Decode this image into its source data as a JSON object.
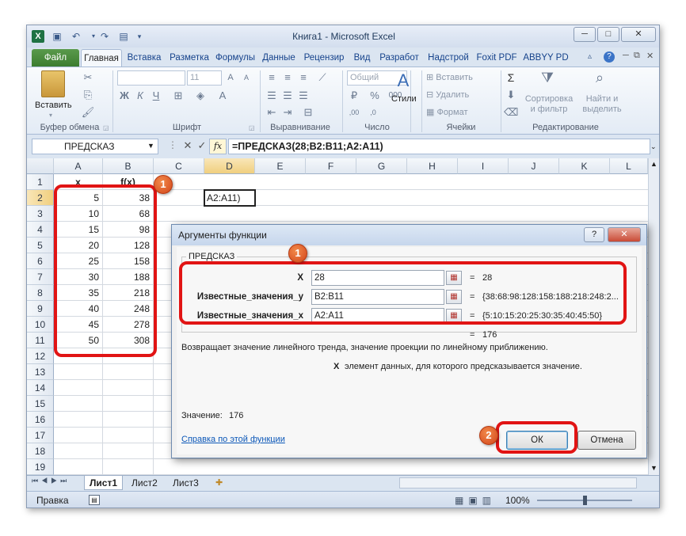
{
  "window": {
    "title": "Книга1 - Microsoft Excel",
    "buttons": {
      "minimize": "─",
      "restore": "□",
      "close": "✕"
    }
  },
  "tabs": [
    "Файл",
    "Главная",
    "Вставка",
    "Разметка",
    "Формулы",
    "Данные",
    "Рецензир",
    "Вид",
    "Разработ",
    "Надстрой",
    "Foxit PDF",
    "ABBYY PD"
  ],
  "ribbon": {
    "clipboard": {
      "paste": "Вставить",
      "label": "Буфер обмена"
    },
    "font": {
      "size": "11",
      "label": "Шрифт"
    },
    "alignment": {
      "label": "Выравнивание"
    },
    "number": {
      "format": "Общий",
      "label": "Число"
    },
    "styles": {
      "styles": "Стили"
    },
    "cells": {
      "insert": "Вставить",
      "delete": "Удалить",
      "format": "Формат",
      "label": "Ячейки"
    },
    "editing": {
      "sort_line1": "Сортировка",
      "sort_line2": "и фильтр",
      "find_line1": "Найти и",
      "find_line2": "выделить",
      "label": "Редактирование"
    }
  },
  "formula_bar": {
    "name_box": "ПРЕДСКАЗ",
    "fx": "fx",
    "formula": "=ПРЕДСКАЗ(28;B2:B11;A2:A11)"
  },
  "grid": {
    "columns": [
      "A",
      "B",
      "C",
      "D",
      "E",
      "F",
      "G",
      "H",
      "I",
      "J",
      "K",
      "L"
    ],
    "rows": [
      "1",
      "2",
      "3",
      "4",
      "5",
      "6",
      "7",
      "8",
      "9",
      "10",
      "11",
      "12",
      "13",
      "14",
      "15",
      "16",
      "17",
      "18",
      "19"
    ],
    "header_row": {
      "a": "x",
      "b": "f(x)"
    },
    "data": [
      [
        "5",
        "38"
      ],
      [
        "10",
        "68"
      ],
      [
        "15",
        "98"
      ],
      [
        "20",
        "128"
      ],
      [
        "25",
        "158"
      ],
      [
        "30",
        "188"
      ],
      [
        "35",
        "218"
      ],
      [
        "40",
        "248"
      ],
      [
        "45",
        "278"
      ],
      [
        "50",
        "308"
      ]
    ],
    "editing_cell_text": "A2:A11)"
  },
  "sheets": {
    "tabs": [
      "Лист1",
      "Лист2",
      "Лист3"
    ],
    "active": "Лист1"
  },
  "status": {
    "mode": "Правка",
    "zoom": "100%"
  },
  "dialog": {
    "title": "Аргументы функции",
    "help_btn": "?",
    "close_btn": "✕",
    "function_name": "ПРЕДСКАЗ",
    "args": [
      {
        "label": "X",
        "value": "28",
        "result": "28"
      },
      {
        "label": "Известные_значения_y",
        "value": "B2:B11",
        "result": "{38:68:98:128:158:188:218:248:2..."
      },
      {
        "label": "Известные_значения_x",
        "value": "A2:A11",
        "result": "{5:10:15:20:25:30:35:40:45:50}"
      }
    ],
    "eq": "=",
    "total_result": "176",
    "description": "Возвращает значение линейного тренда, значение проекции по линейному приближению.",
    "arg_name": "X",
    "arg_description": "элемент данных, для которого предсказывается значение.",
    "value_label": "Значение:",
    "value": "176",
    "help_link": "Справка по этой функции",
    "ok": "ОК",
    "cancel": "Отмена"
  },
  "annotations": {
    "badge1": "1",
    "badge2": "2"
  }
}
